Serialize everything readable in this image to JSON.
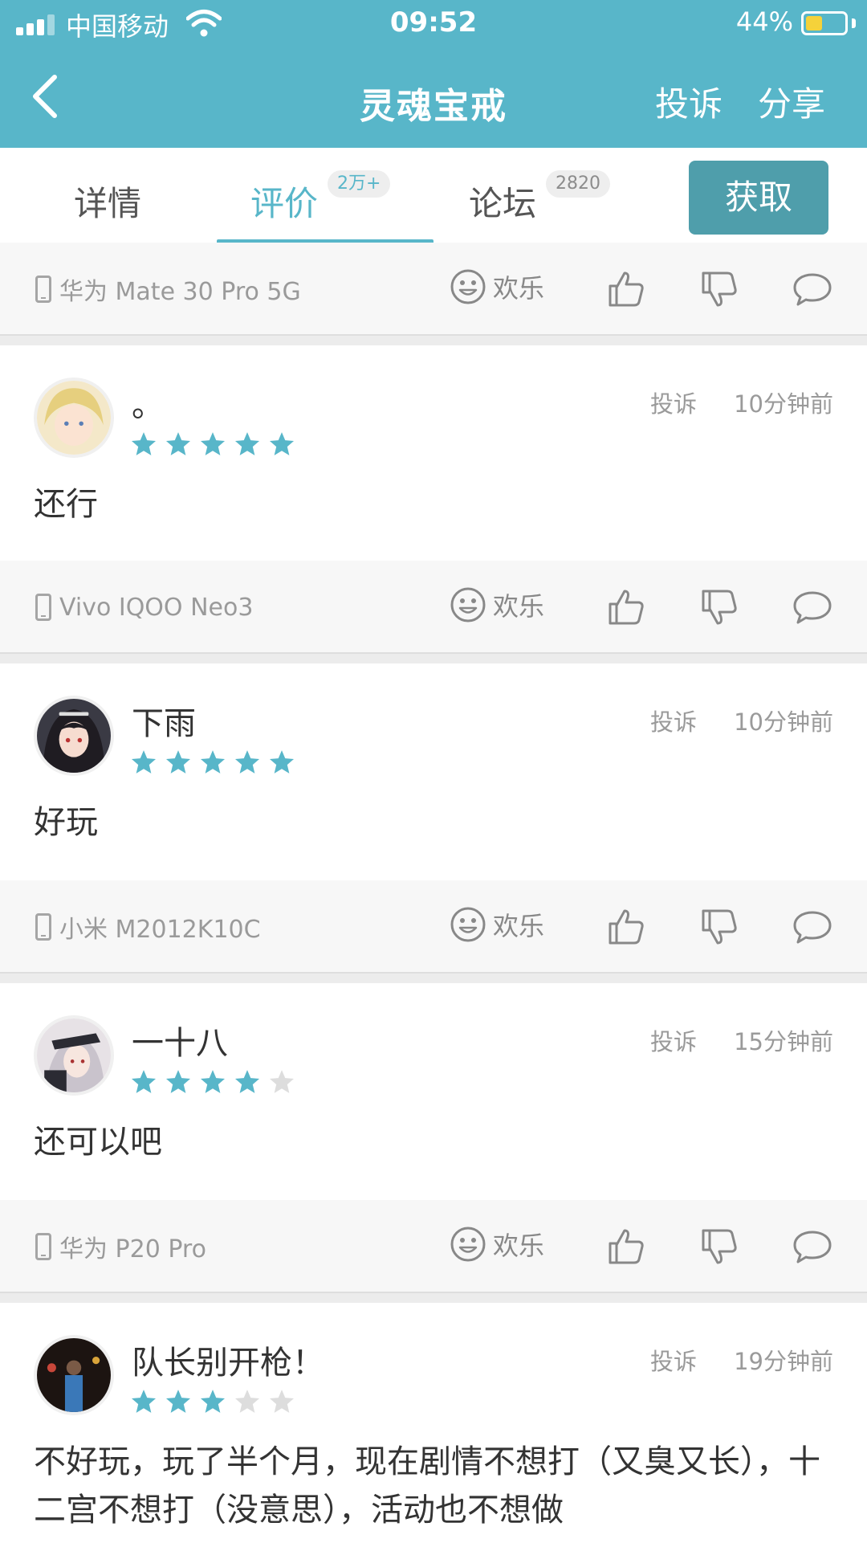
{
  "status_bar": {
    "carrier": "中国移动",
    "time": "09:52",
    "battery_percent": "44%",
    "battery_level": 0.44
  },
  "header": {
    "title": "灵魂宝戒",
    "report_label": "投诉",
    "share_label": "分享"
  },
  "tabs": {
    "detail": "详情",
    "review": "评价",
    "review_badge": "2万+",
    "forum": "论坛",
    "forum_badge": "2820",
    "get_button": "获取"
  },
  "colors": {
    "accent": "#58b6c9",
    "get_button": "#4f9eab",
    "star_on": "#58b6c9",
    "star_off": "#dddddd"
  },
  "common": {
    "mood_label": "欢乐",
    "report_label": "投诉"
  },
  "top_footer": {
    "device": "华为 Mate 30 Pro 5G"
  },
  "reviews": [
    {
      "username": "。",
      "rating": 5,
      "time": "10分钟前",
      "content": "还行",
      "device": "Vivo IQOO Neo3"
    },
    {
      "username": "下雨",
      "rating": 5,
      "time": "10分钟前",
      "content": "好玩",
      "device": "小米 M2012K10C"
    },
    {
      "username": "一十八",
      "rating": 4,
      "time": "15分钟前",
      "content": "还可以吧",
      "device": "华为 P20 Pro"
    },
    {
      "username": "队长别开枪！",
      "rating": 3,
      "time": "19分钟前",
      "content": "不好玩，玩了半个月，现在剧情不想打（又臭又长），十二宫不想打（没意思），活动也不想做"
    }
  ]
}
